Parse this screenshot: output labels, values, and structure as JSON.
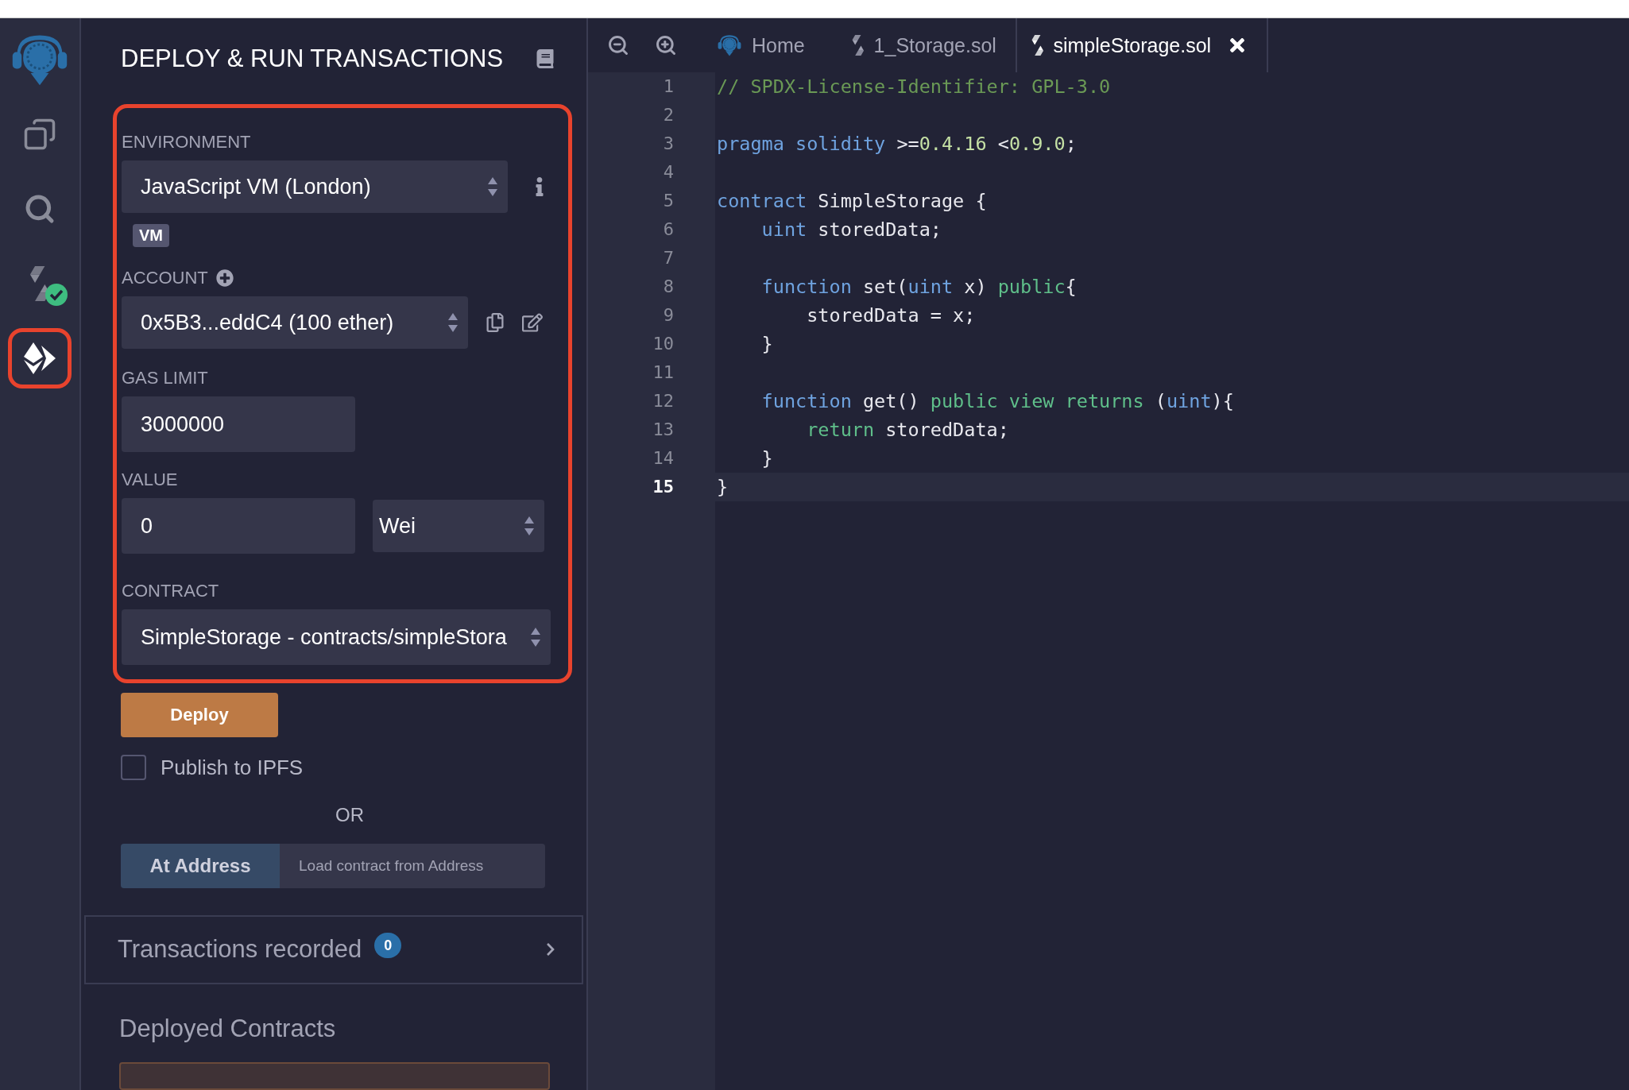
{
  "sidebar": {
    "items": [
      {
        "kind": "logo"
      },
      {
        "kind": "files",
        "selected": false,
        "highlighted": false
      },
      {
        "kind": "search",
        "selected": false,
        "highlighted": false
      },
      {
        "kind": "compiler",
        "selected": false,
        "highlighted": false,
        "compiled": true
      },
      {
        "kind": "deploy",
        "selected": true,
        "highlighted": true
      }
    ]
  },
  "panel": {
    "title": "DEPLOY & RUN TRANSACTIONS",
    "form": {
      "highlighted": true,
      "environment": {
        "label": "ENVIRONMENT",
        "value": "JavaScript VM (London)",
        "badge": "VM"
      },
      "account": {
        "label": "ACCOUNT",
        "value": "0x5B3...eddC4 (100 ether)"
      },
      "gas_limit": {
        "label": "GAS LIMIT",
        "value": "3000000"
      },
      "value": {
        "label": "VALUE",
        "value": "0",
        "unit": "Wei"
      },
      "contract": {
        "label": "CONTRACT",
        "value": "SimpleStorage - contracts/simpleStora"
      }
    },
    "deploy_button": "Deploy",
    "publish": {
      "label": "Publish to IPFS",
      "checked": false
    },
    "or": "OR",
    "at_address": {
      "button": "At Address",
      "placeholder": "Load contract from Address"
    },
    "transactions": {
      "label": "Transactions recorded",
      "count": "0",
      "expanded": false
    },
    "deployed_contracts": "Deployed Contracts"
  },
  "editor": {
    "tabs": [
      {
        "kind": "home",
        "label": "Home",
        "selected": false,
        "closable": false
      },
      {
        "kind": "file",
        "label": "1_Storage.sol",
        "selected": false,
        "closable": false
      },
      {
        "kind": "file",
        "label": "simpleStorage.sol",
        "selected": true,
        "closable": true
      }
    ],
    "lines": [
      {
        "number": "1",
        "current": false,
        "tokens": [
          {
            "kind": "comment",
            "text": "// SPDX-License-Identifier: GPL-3.0"
          }
        ]
      },
      {
        "number": "2",
        "current": false
      },
      {
        "number": "3",
        "current": false,
        "tokens": [
          {
            "kind": "keyword",
            "text": "pragma solidity"
          },
          {
            "kind": "plain",
            "text": " >="
          },
          {
            "kind": "number",
            "text": "0.4.16"
          },
          {
            "kind": "plain",
            "text": " <"
          },
          {
            "kind": "number",
            "text": "0.9.0"
          },
          {
            "kind": "plain",
            "text": ";"
          }
        ]
      },
      {
        "number": "4",
        "current": false
      },
      {
        "number": "5",
        "current": false,
        "tokens": [
          {
            "kind": "keyword",
            "text": "contract"
          },
          {
            "kind": "plain",
            "text": " SimpleStorage {"
          }
        ]
      },
      {
        "number": "6",
        "current": false,
        "tokens": [
          {
            "kind": "keyword",
            "text": "    uint"
          },
          {
            "kind": "plain",
            "text": " storedData;"
          }
        ]
      },
      {
        "number": "7",
        "current": false
      },
      {
        "number": "8",
        "current": false,
        "tokens": [
          {
            "kind": "keyword",
            "text": "    function"
          },
          {
            "kind": "plain",
            "text": " set("
          },
          {
            "kind": "keyword",
            "text": "uint"
          },
          {
            "kind": "plain",
            "text": " x) "
          },
          {
            "kind": "modifier",
            "text": "public"
          },
          {
            "kind": "plain",
            "text": "{"
          }
        ]
      },
      {
        "number": "9",
        "current": false,
        "tokens": [
          {
            "kind": "plain",
            "text": "        storedData = x;"
          }
        ]
      },
      {
        "number": "10",
        "current": false,
        "tokens": [
          {
            "kind": "plain",
            "text": "    }"
          }
        ]
      },
      {
        "number": "11",
        "current": false
      },
      {
        "number": "12",
        "current": false,
        "tokens": [
          {
            "kind": "keyword",
            "text": "    function"
          },
          {
            "kind": "plain",
            "text": " get() "
          },
          {
            "kind": "modifier",
            "text": "public view returns"
          },
          {
            "kind": "plain",
            "text": " ("
          },
          {
            "kind": "keyword",
            "text": "uint"
          },
          {
            "kind": "plain",
            "text": "){"
          }
        ]
      },
      {
        "number": "13",
        "current": false,
        "tokens": [
          {
            "kind": "modifier",
            "text": "        return"
          },
          {
            "kind": "plain",
            "text": " storedData;"
          }
        ]
      },
      {
        "number": "14",
        "current": false,
        "tokens": [
          {
            "kind": "plain",
            "text": "    }"
          }
        ]
      },
      {
        "number": "15",
        "current": true,
        "tokens": [
          {
            "kind": "plain",
            "text": "}"
          }
        ]
      }
    ]
  }
}
